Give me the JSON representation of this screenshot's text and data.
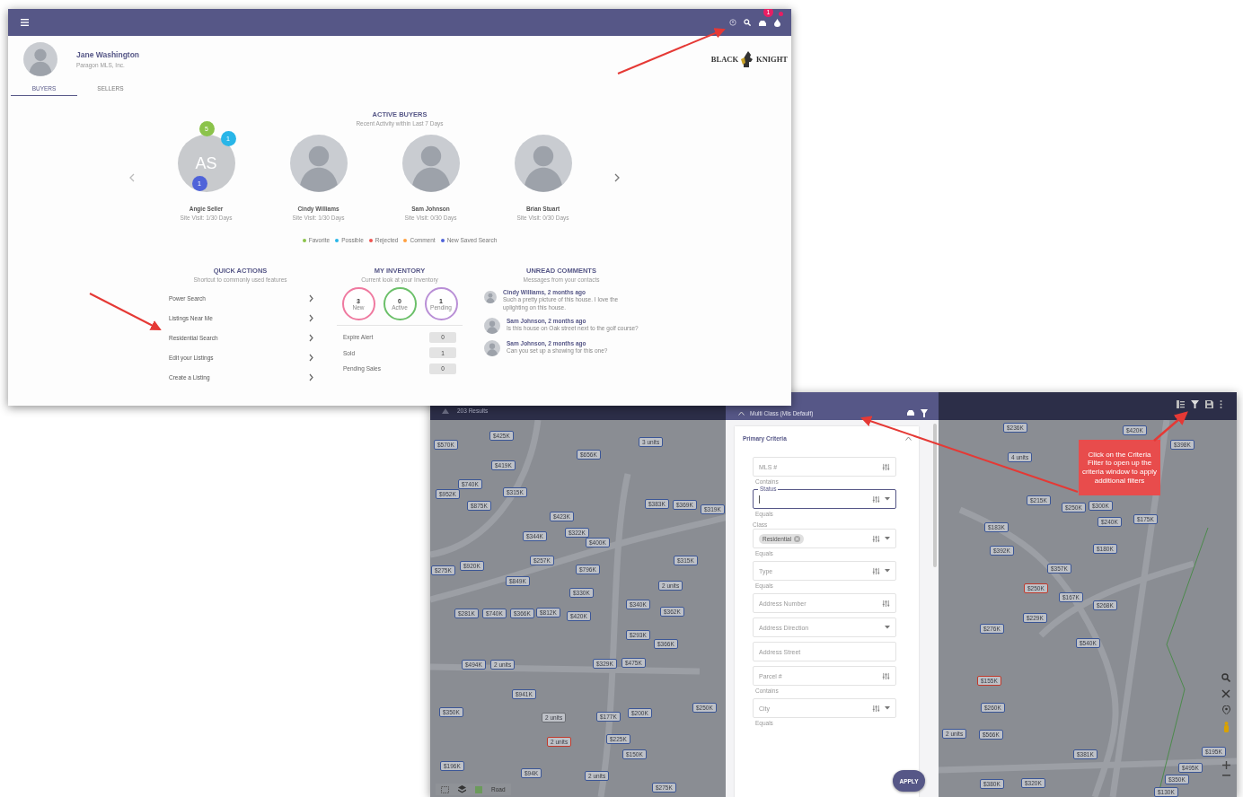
{
  "dashboard": {
    "header": {
      "notification_count": "1"
    },
    "user": {
      "name": "Jane Washington",
      "company": "Paragon MLS, Inc."
    },
    "tabs": [
      {
        "label": "BUYERS",
        "selected": true
      },
      {
        "label": "SELLERS",
        "selected": false
      }
    ],
    "logo": {
      "left": "BLACK",
      "right": "KNIGHT"
    },
    "active_buyers": {
      "title": "ACTIVE BUYERS",
      "subtitle": "Recent Activity within Last 7 Days",
      "buyers": [
        {
          "name": "Angie Seller",
          "visits": "Site Visit: 1/30 Days",
          "kind": "initials",
          "initials": "AS",
          "badges": [
            {
              "count": "5",
              "color": "#8bc34a"
            },
            {
              "count": "1",
              "color": "#29b6e8"
            },
            {
              "count": "1",
              "color": "#4f63d9"
            }
          ]
        },
        {
          "name": "Cindy Williams",
          "visits": "Site Visit: 1/30 Days",
          "kind": "photo"
        },
        {
          "name": "Sam Johnson",
          "visits": "Site Visit: 0/30 Days",
          "kind": "photo"
        },
        {
          "name": "Brian Stuart",
          "visits": "Site Visit: 0/30 Days",
          "kind": "photo"
        }
      ]
    },
    "legend": [
      {
        "label": "Favorite",
        "color": "#8bc34a"
      },
      {
        "label": "Possible",
        "color": "#29b6e8"
      },
      {
        "label": "Rejected",
        "color": "#ef5350"
      },
      {
        "label": "Comment",
        "color": "#ffa040"
      },
      {
        "label": "New Saved Search",
        "color": "#4f63d9"
      }
    ],
    "quick_actions": {
      "title": "QUICK ACTIONS",
      "subtitle": "Shortcut to commonly used features",
      "items": [
        "Power Search",
        "Listings Near Me",
        "Residential Search",
        "Edit your Listings",
        "Create a Listing"
      ]
    },
    "inventory": {
      "title": "MY INVENTORY",
      "subtitle": "Current look at your Inventory",
      "counters": [
        {
          "count": "3",
          "label": "New",
          "color": "#ef7aa0"
        },
        {
          "count": "0",
          "label": "Active",
          "color": "#6cc06a"
        },
        {
          "count": "1",
          "label": "Pending",
          "color": "#b98fd6"
        }
      ],
      "rows": [
        {
          "label": "Expire Alert",
          "value": "0"
        },
        {
          "label": "Sold",
          "value": "1"
        },
        {
          "label": "Pending Sales",
          "value": "0"
        }
      ]
    },
    "comments": {
      "title": "UNREAD COMMENTS",
      "subtitle": "Messages from your contacts",
      "items": [
        {
          "author": "Cindy Williams, 2 months ago",
          "text": "Such a pretty picture of this house. I love the uplighting on this house."
        },
        {
          "author": "Sam Johnson, 2 months ago",
          "text": "Is this house on Oak street next to the golf course?"
        },
        {
          "author": "Sam Johnson, 2 months ago",
          "text": "Can you set up a showing for this one?"
        }
      ]
    }
  },
  "map_view": {
    "results": "203 Results",
    "criteria": {
      "title": "Multi Class (Mls Default)",
      "section": "Primary Criteria",
      "expanded": true,
      "fields": [
        {
          "kind": "text",
          "label": "MLS #",
          "helper": "Contains",
          "operator": true,
          "dropdown": false,
          "focused": false
        },
        {
          "kind": "text",
          "label": "Status",
          "helper": "Equals",
          "operator": true,
          "dropdown": true,
          "focused": true
        },
        {
          "kind": "chips",
          "label": "Class",
          "chip": "Residential",
          "helper": "Equals",
          "operator": true,
          "dropdown": true,
          "focused": false
        },
        {
          "kind": "text",
          "label": "Type",
          "helper": "Equals",
          "operator": true,
          "dropdown": true,
          "focused": false
        },
        {
          "kind": "text",
          "label": "Address Number",
          "operator": true,
          "dropdown": false,
          "focused": false
        },
        {
          "kind": "text",
          "label": "Address Direction",
          "operator": false,
          "dropdown": true,
          "focused": false
        },
        {
          "kind": "text",
          "label": "Address Street",
          "operator": false,
          "dropdown": false,
          "focused": false
        },
        {
          "kind": "text",
          "label": "Parcel #",
          "helper": "Contains",
          "operator": true,
          "dropdown": false,
          "focused": false
        },
        {
          "kind": "text",
          "label": "City",
          "helper": "Equals",
          "operator": true,
          "dropdown": true,
          "focused": false
        }
      ],
      "apply": "APPLY"
    },
    "base_layer": "Road",
    "callout": "Click on the Criteria Filter to open up the criteria window to apply additional filters",
    "pins": [
      {
        "label": "$570K",
        "color": "#3b5696"
      },
      {
        "label": "$425K",
        "color": "#3b5696"
      },
      {
        "label": "$419K",
        "color": "#3b5696"
      },
      {
        "label": "$740K",
        "color": "#3b5696"
      },
      {
        "label": "$952K",
        "color": "#3b5696"
      },
      {
        "label": "$315K",
        "color": "#3b5696"
      },
      {
        "label": "$875K",
        "color": "#3b5696"
      },
      {
        "label": "$423K",
        "color": "#3b5696"
      },
      {
        "label": "$344K",
        "color": "#3b5696"
      },
      {
        "label": "$322K",
        "color": "#3b5696"
      },
      {
        "label": "$400K",
        "color": "#3b5696"
      },
      {
        "label": "$257K",
        "color": "#3b5696"
      },
      {
        "label": "$275K",
        "color": "#3b5696"
      },
      {
        "label": "$920K",
        "color": "#3b5696"
      },
      {
        "label": "$849K",
        "color": "#3b5696"
      },
      {
        "label": "$796K",
        "color": "#3b5696"
      },
      {
        "label": "$330K",
        "color": "#3b5696"
      },
      {
        "label": "$420K",
        "color": "#3b5696"
      },
      {
        "label": "$281K",
        "color": "#3b5696"
      },
      {
        "label": "$740K",
        "color": "#3b5696"
      },
      {
        "label": "$366K",
        "color": "#3b5696"
      },
      {
        "label": "$812K",
        "color": "#3b5696"
      },
      {
        "label": "$340K",
        "color": "#3b5696"
      },
      {
        "label": "$362K",
        "color": "#3b5696"
      },
      {
        "label": "$293K",
        "color": "#3b5696"
      },
      {
        "label": "$366K",
        "color": "#3b5696"
      },
      {
        "label": "2 units",
        "color": "#3b5696"
      },
      {
        "label": "3 units",
        "color": "#3b5696"
      },
      {
        "label": "$656K",
        "color": "#3b5696"
      },
      {
        "label": "$383K",
        "color": "#3b5696"
      },
      {
        "label": "$369K",
        "color": "#3b5696"
      },
      {
        "label": "$319K",
        "color": "#3b5696"
      },
      {
        "label": "$315K",
        "color": "#3b5696"
      },
      {
        "label": "$494K",
        "color": "#3b5696"
      },
      {
        "label": "2 units",
        "color": "#3b5696"
      },
      {
        "label": "$329K",
        "color": "#3b5696"
      },
      {
        "label": "$475K",
        "color": "#3b5696"
      },
      {
        "label": "$941K",
        "color": "#3b5696"
      },
      {
        "label": "$350K",
        "color": "#3b5696"
      },
      {
        "label": "2 units",
        "color": "#6b6e74"
      },
      {
        "label": "2 units",
        "color": "#c0392b"
      },
      {
        "label": "$177K",
        "color": "#3b5696"
      },
      {
        "label": "$200K",
        "color": "#3b5696"
      },
      {
        "label": "$250K",
        "color": "#3b5696"
      },
      {
        "label": "$225K",
        "color": "#3b5696"
      },
      {
        "label": "$150K",
        "color": "#3b5696"
      },
      {
        "label": "$196K",
        "color": "#3b5696"
      },
      {
        "label": "$94K",
        "color": "#3b5696"
      },
      {
        "label": "2 units",
        "color": "#3b5696"
      },
      {
        "label": "$275K",
        "color": "#3b5696"
      },
      {
        "label": "$236K",
        "color": "#3b5696"
      },
      {
        "label": "$420K",
        "color": "#3b5696"
      },
      {
        "label": "$398K",
        "color": "#3b5696"
      },
      {
        "label": "4 units",
        "color": "#3b5696"
      },
      {
        "label": "$215K",
        "color": "#3b5696"
      },
      {
        "label": "$250K",
        "color": "#3b5696"
      },
      {
        "label": "$300K",
        "color": "#3b5696"
      },
      {
        "label": "$240K",
        "color": "#3b5696"
      },
      {
        "label": "$175K",
        "color": "#3b5696"
      },
      {
        "label": "$183K",
        "color": "#3b5696"
      },
      {
        "label": "$392K",
        "color": "#3b5696"
      },
      {
        "label": "$180K",
        "color": "#3b5696"
      },
      {
        "label": "$357K",
        "color": "#3b5696"
      },
      {
        "label": "$250K",
        "color": "#c0392b"
      },
      {
        "label": "$167K",
        "color": "#3b5696"
      },
      {
        "label": "$268K",
        "color": "#3b5696"
      },
      {
        "label": "$229K",
        "color": "#3b5696"
      },
      {
        "label": "$276K",
        "color": "#3b5696"
      },
      {
        "label": "$540K",
        "color": "#3b5696"
      },
      {
        "label": "$155K",
        "color": "#c0392b"
      },
      {
        "label": "$260K",
        "color": "#3b5696"
      },
      {
        "label": "2 units",
        "color": "#3b5696"
      },
      {
        "label": "$566K",
        "color": "#3b5696"
      },
      {
        "label": "$381K",
        "color": "#3b5696"
      },
      {
        "label": "$380K",
        "color": "#3b5696"
      },
      {
        "label": "$320K",
        "color": "#3b5696"
      },
      {
        "label": "$195K",
        "color": "#3b5696"
      },
      {
        "label": "$495K",
        "color": "#3b5696"
      },
      {
        "label": "$350K",
        "color": "#3b5696"
      },
      {
        "label": "$130K",
        "color": "#3b5696"
      }
    ]
  }
}
